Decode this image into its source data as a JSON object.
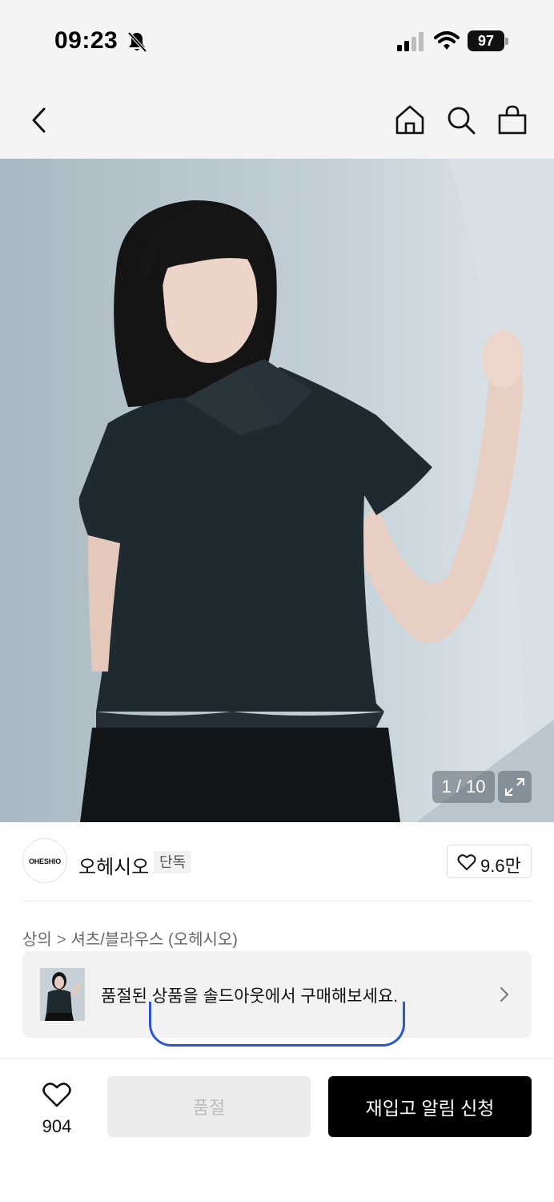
{
  "status_bar": {
    "time": "09:23",
    "battery": "97"
  },
  "nav": {
    "icons": [
      "back-icon",
      "home-icon",
      "search-icon",
      "shopping-bag-icon"
    ]
  },
  "gallery": {
    "counter": "1 / 10",
    "current_index": 1,
    "total": 10
  },
  "brand": {
    "logo_text": "OHESHIO",
    "name": "오헤시오",
    "badge": "단독",
    "likes": "9.6만"
  },
  "breadcrumb": {
    "category": "상의",
    "subcategory": "셔츠/블라우스 (오헤시오)"
  },
  "soldout_banner": {
    "text": "품절된 상품을 솔드아웃에서 구매해보세요."
  },
  "bottom_bar": {
    "wish_count": "904",
    "soldout_label": "품절",
    "restock_label": "재입고 알림 신청"
  },
  "colors": {
    "primary": "#000000",
    "disabled_bg": "#ececec",
    "disabled_text": "#bdbdbd",
    "pill_border": "#2a56d0"
  }
}
